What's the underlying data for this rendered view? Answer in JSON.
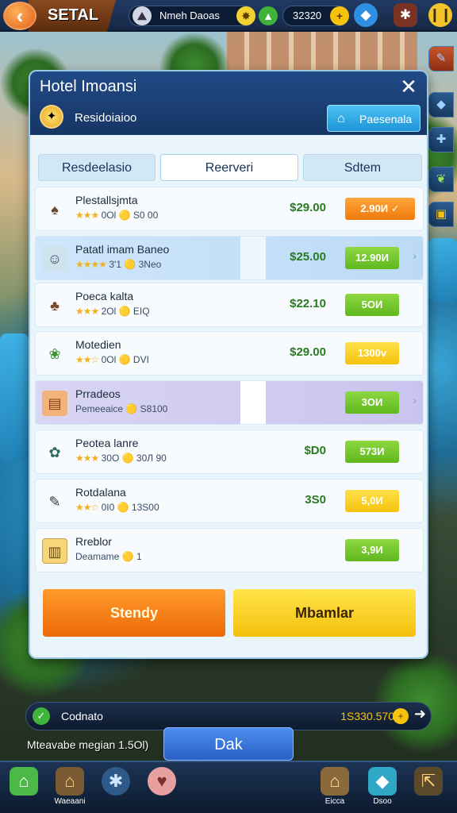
{
  "topbar": {
    "title": "SETAL",
    "location": "Nmeh Daoas",
    "currency_value": "32320",
    "back_icon": "back-arrow-icon"
  },
  "panel": {
    "title": "Hotel Imoansi",
    "subtitle": "Residoiaioo",
    "action_label": "Paesenala",
    "tabs": [
      {
        "label": "Resdeelasio"
      },
      {
        "label": "Reerveri"
      },
      {
        "label": "Sdtem"
      }
    ],
    "rows": [
      {
        "name": "Plestallsjmta",
        "meta": "0Ol 🟡 S0 00",
        "stars": "★★★",
        "price": "$29.00",
        "button": "2.90И",
        "btn_color": "orange",
        "icon": "lamp-icon"
      },
      {
        "name": "Patatl imam Baneo",
        "meta": "3'1 🟡 3Neo",
        "stars": "★★★★",
        "price": "$25.00",
        "button": "12.90И",
        "btn_color": "green",
        "icon": "portrait-icon"
      },
      {
        "name": "Poeca kalta",
        "meta": "2Ol 🟡 EIQ",
        "stars": "★★★",
        "price": "$22.10",
        "button": "5ОИ",
        "btn_color": "green",
        "icon": "mushroom-icon"
      },
      {
        "name": "Motedien",
        "meta": "0Ol 🟡 DVI",
        "stars": "★★☆",
        "price": "$29.00",
        "button": "1300v",
        "btn_color": "yellow",
        "icon": "plant-icon"
      },
      {
        "name": "Prradeos",
        "meta": "Pemeeaice 🟡 S8100",
        "stars": "",
        "price": "",
        "button": "3OИ",
        "btn_color": "green",
        "icon": "food-tray-icon"
      },
      {
        "name": "Peotea lanre",
        "meta": "30O 🟡 30Л 90",
        "stars": "★★★",
        "price": "$D0",
        "button": "573И",
        "btn_color": "green",
        "icon": "plant-pot-icon"
      },
      {
        "name": "Rotdalana",
        "meta": "0I0 🟡 13S00",
        "stars": "★★☆",
        "price": "3S0",
        "button": "5,0И",
        "btn_color": "yellow",
        "icon": "pipe-icon"
      },
      {
        "name": "Rreblor",
        "meta": "Deamame 🟡 1",
        "stars": "",
        "price": "",
        "button": "3,9И",
        "btn_color": "green",
        "icon": "crate-icon"
      }
    ],
    "btn_left": "Stendy",
    "btn_right": "Mbamlar"
  },
  "info_bar": {
    "label": "Codnato",
    "value": "1S330.570"
  },
  "footer_text": "Mteavabe megian  1.5Ol)",
  "dak_label": "Dak",
  "navbar": [
    {
      "label": "",
      "icon": "home-icon"
    },
    {
      "label": "Waeaani",
      "icon": "house-icon"
    },
    {
      "label": "",
      "icon": "gear-globe-icon"
    },
    {
      "label": "",
      "icon": "pig-icon"
    },
    {
      "label": "Eicca",
      "icon": "building-icon"
    },
    {
      "label": "Dsoo",
      "icon": "cube-icon"
    },
    {
      "label": "",
      "icon": "exit-icon"
    }
  ],
  "colors": {
    "accent_orange": "#ef7a0c",
    "accent_green": "#5fb81d",
    "accent_yellow": "#f6c20c",
    "panel_header": "#1f4580"
  }
}
